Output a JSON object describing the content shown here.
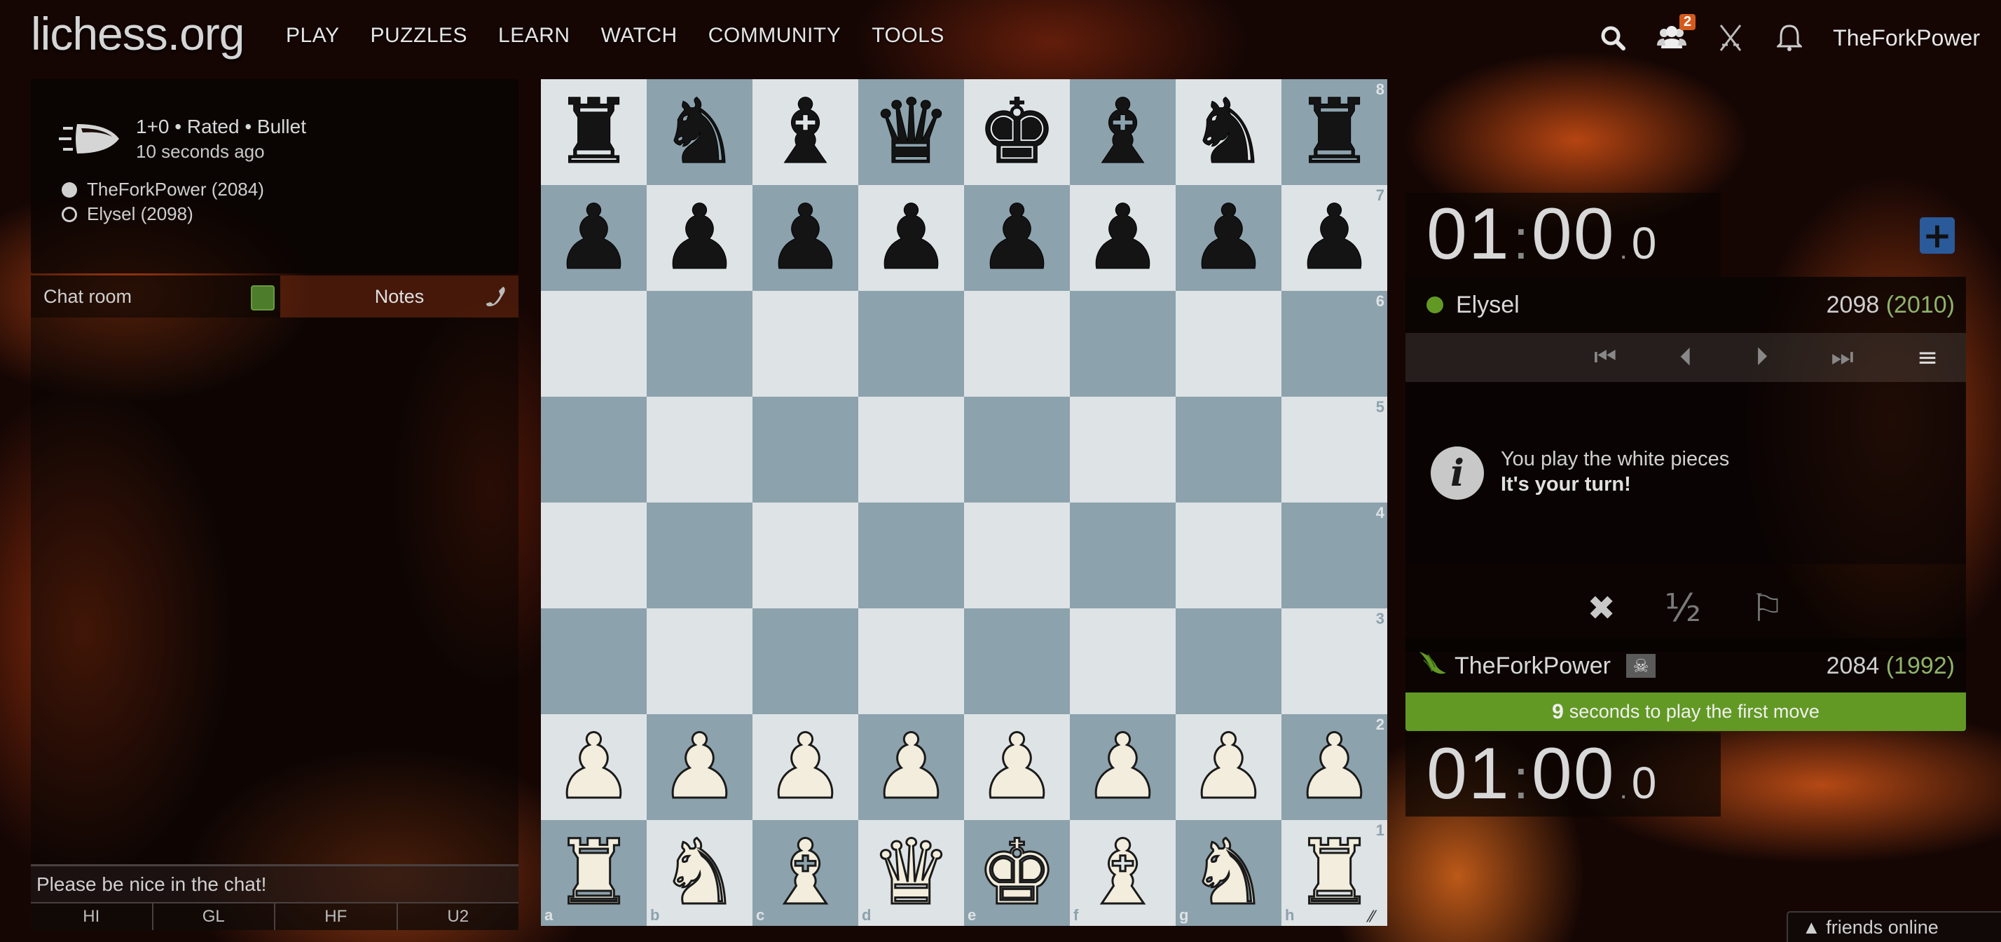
{
  "header": {
    "logo": "lichess.org",
    "nav": [
      "PLAY",
      "PUZZLES",
      "LEARN",
      "WATCH",
      "COMMUNITY",
      "TOOLS"
    ],
    "friends_badge": "2",
    "username": "TheForkPower",
    "icons": [
      "search-icon",
      "friends-icon",
      "challenge-swords-icon",
      "notification-bell-icon"
    ]
  },
  "game_info": {
    "icon": "bullet-icon",
    "title": "1+0 • Rated • Bullet",
    "time_ago": "10 seconds ago",
    "players": [
      {
        "color": "white",
        "label": "TheForkPower (2084)"
      },
      {
        "color": "black",
        "label": "Elysel (2098)"
      }
    ]
  },
  "chat": {
    "tab_chat": "Chat room",
    "tab_notes": "Notes",
    "chat_enabled": true,
    "input_placeholder": "Please be nice in the chat!",
    "presets": [
      "HI",
      "GL",
      "HF",
      "U2"
    ]
  },
  "board": {
    "orientation": "white",
    "colors": {
      "light": "#dee3e6",
      "dark": "#8ca2ad"
    },
    "ranks": [
      "8",
      "7",
      "6",
      "5",
      "4",
      "3",
      "2",
      "1"
    ],
    "files": [
      "a",
      "b",
      "c",
      "d",
      "e",
      "f",
      "g",
      "h"
    ],
    "position": [
      [
        "r",
        "n",
        "b",
        "q",
        "k",
        "b",
        "n",
        "r"
      ],
      [
        "p",
        "p",
        "p",
        "p",
        "p",
        "p",
        "p",
        "p"
      ],
      [
        "",
        "",
        "",
        "",
        "",
        "",
        "",
        ""
      ],
      [
        "",
        "",
        "",
        "",
        "",
        "",
        "",
        ""
      ],
      [
        "",
        "",
        "",
        "",
        "",
        "",
        "",
        ""
      ],
      [
        "",
        "",
        "",
        "",
        "",
        "",
        "",
        ""
      ],
      [
        "P",
        "P",
        "P",
        "P",
        "P",
        "P",
        "P",
        "P"
      ],
      [
        "R",
        "N",
        "B",
        "Q",
        "K",
        "B",
        "N",
        "R"
      ]
    ]
  },
  "opponent": {
    "name": "Elysel",
    "online": true,
    "rating": "2098",
    "provisional": "(2010)",
    "clock": {
      "main": "01",
      "sep": ":",
      "sec": "00",
      "dot": ".",
      "tenths": "0"
    }
  },
  "controls": {
    "first": "⏮",
    "prev": "⏴",
    "next": "⏵",
    "last": "⏭",
    "menu": "≡"
  },
  "info": {
    "line1": "You play the white pieces",
    "line2": "It's your turn!"
  },
  "actions": {
    "abort": "✖",
    "draw": "½",
    "resign": "⚐"
  },
  "player": {
    "name": "TheForkPower",
    "patron_icon": "patron-wings-icon",
    "flair": "☠",
    "rating": "2084",
    "provisional": "(1992)",
    "clock": {
      "main": "01",
      "sep": ":",
      "sec": "00",
      "dot": ".",
      "tenths": "0"
    }
  },
  "first_move": {
    "seconds": "9",
    "text": "seconds to play the first move",
    "color": "#629924"
  },
  "friends": {
    "label": "▲ friends online"
  }
}
